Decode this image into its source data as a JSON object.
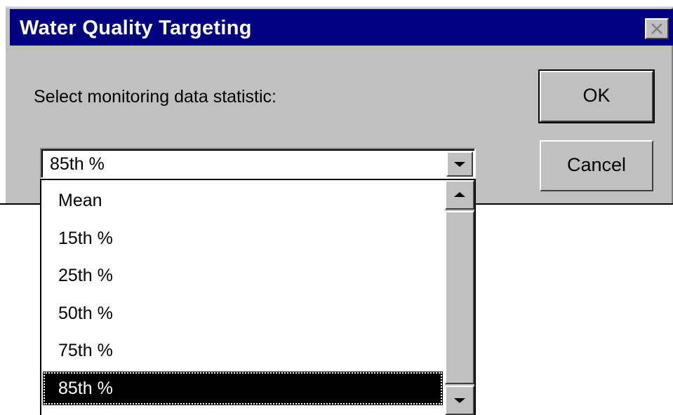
{
  "window": {
    "title": "Water Quality Targeting",
    "close_icon": "close-icon"
  },
  "form": {
    "prompt": "Select monitoring data statistic:",
    "selected_value": "85th %"
  },
  "buttons": {
    "ok_label": "OK",
    "cancel_label": "Cancel"
  },
  "dropdown": {
    "options": [
      {
        "label": "Mean"
      },
      {
        "label": "15th %"
      },
      {
        "label": "25th %"
      },
      {
        "label": "50th %"
      },
      {
        "label": "75th %"
      },
      {
        "label": "85th %",
        "selected": true
      }
    ],
    "icons": {
      "combo_arrow": "chevron-down-icon",
      "scroll_up": "scroll-up-arrow-icon",
      "scroll_down": "scroll-down-arrow-icon"
    }
  },
  "colors": {
    "titlebar": "#000080",
    "dialog_face": "#c0c0c0",
    "selection": "#000000"
  }
}
